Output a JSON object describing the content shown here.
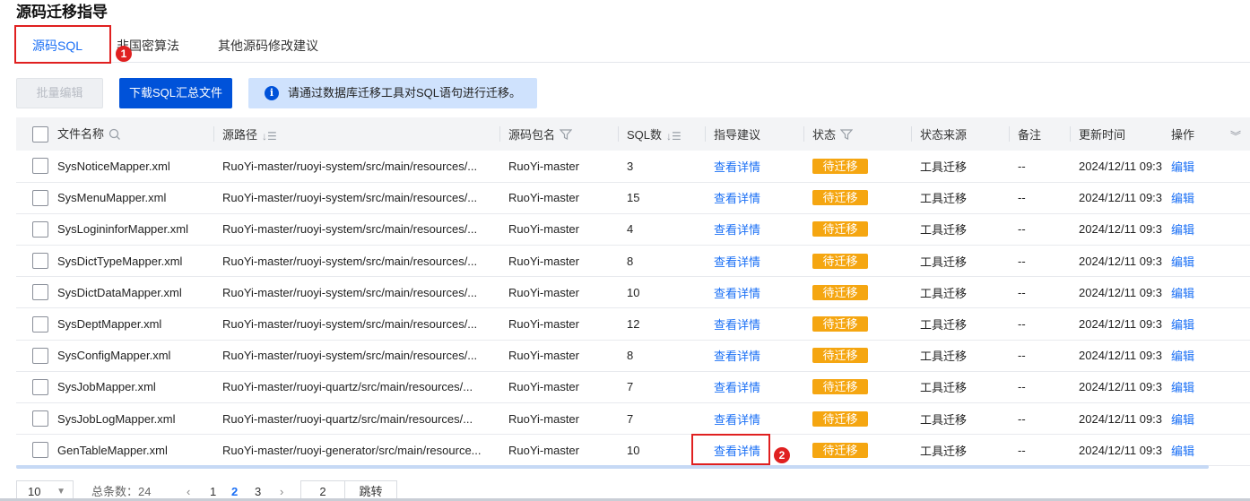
{
  "page": {
    "title": "源码迁移指导"
  },
  "tabs": [
    {
      "label": "源码SQL",
      "active": true
    },
    {
      "label": "非国密算法",
      "active": false
    },
    {
      "label": "其他源码修改建议",
      "active": false
    }
  ],
  "annotations": {
    "badge1": "1",
    "badge2": "2"
  },
  "toolbar": {
    "batch_edit": "批量编辑",
    "download": "下载SQL汇总文件",
    "notice_icon": "i",
    "notice": "请通过数据库迁移工具对SQL语句进行迁移。"
  },
  "table": {
    "headers": {
      "name": "文件名称",
      "path": "源路径",
      "package": "源码包名",
      "sql_count": "SQL数",
      "guide": "指导建议",
      "status": "状态",
      "status_source": "状态来源",
      "note": "备注",
      "update_time": "更新时间",
      "operation": "操作"
    },
    "rows": [
      {
        "name": "SysNoticeMapper.xml",
        "path": "RuoYi-master/ruoyi-system/src/main/resources/...",
        "package": "RuoYi-master",
        "sql_count": "3",
        "guide": "查看详情",
        "status": "待迁移",
        "status_source": "工具迁移",
        "note": "--",
        "update_time": "2024/12/11 09:3",
        "operation": "编辑"
      },
      {
        "name": "SysMenuMapper.xml",
        "path": "RuoYi-master/ruoyi-system/src/main/resources/...",
        "package": "RuoYi-master",
        "sql_count": "15",
        "guide": "查看详情",
        "status": "待迁移",
        "status_source": "工具迁移",
        "note": "--",
        "update_time": "2024/12/11 09:3",
        "operation": "编辑"
      },
      {
        "name": "SysLogininforMapper.xml",
        "path": "RuoYi-master/ruoyi-system/src/main/resources/...",
        "package": "RuoYi-master",
        "sql_count": "4",
        "guide": "查看详情",
        "status": "待迁移",
        "status_source": "工具迁移",
        "note": "--",
        "update_time": "2024/12/11 09:3",
        "operation": "编辑"
      },
      {
        "name": "SysDictTypeMapper.xml",
        "path": "RuoYi-master/ruoyi-system/src/main/resources/...",
        "package": "RuoYi-master",
        "sql_count": "8",
        "guide": "查看详情",
        "status": "待迁移",
        "status_source": "工具迁移",
        "note": "--",
        "update_time": "2024/12/11 09:3",
        "operation": "编辑"
      },
      {
        "name": "SysDictDataMapper.xml",
        "path": "RuoYi-master/ruoyi-system/src/main/resources/...",
        "package": "RuoYi-master",
        "sql_count": "10",
        "guide": "查看详情",
        "status": "待迁移",
        "status_source": "工具迁移",
        "note": "--",
        "update_time": "2024/12/11 09:3",
        "operation": "编辑"
      },
      {
        "name": "SysDeptMapper.xml",
        "path": "RuoYi-master/ruoyi-system/src/main/resources/...",
        "package": "RuoYi-master",
        "sql_count": "12",
        "guide": "查看详情",
        "status": "待迁移",
        "status_source": "工具迁移",
        "note": "--",
        "update_time": "2024/12/11 09:3",
        "operation": "编辑"
      },
      {
        "name": "SysConfigMapper.xml",
        "path": "RuoYi-master/ruoyi-system/src/main/resources/...",
        "package": "RuoYi-master",
        "sql_count": "8",
        "guide": "查看详情",
        "status": "待迁移",
        "status_source": "工具迁移",
        "note": "--",
        "update_time": "2024/12/11 09:3",
        "operation": "编辑"
      },
      {
        "name": "SysJobMapper.xml",
        "path": "RuoYi-master/ruoyi-quartz/src/main/resources/...",
        "package": "RuoYi-master",
        "sql_count": "7",
        "guide": "查看详情",
        "status": "待迁移",
        "status_source": "工具迁移",
        "note": "--",
        "update_time": "2024/12/11 09:3",
        "operation": "编辑"
      },
      {
        "name": "SysJobLogMapper.xml",
        "path": "RuoYi-master/ruoyi-quartz/src/main/resources/...",
        "package": "RuoYi-master",
        "sql_count": "7",
        "guide": "查看详情",
        "status": "待迁移",
        "status_source": "工具迁移",
        "note": "--",
        "update_time": "2024/12/11 09:3",
        "operation": "编辑"
      },
      {
        "name": "GenTableMapper.xml",
        "path": "RuoYi-master/ruoyi-generator/src/main/resource...",
        "package": "RuoYi-master",
        "sql_count": "10",
        "guide": "查看详情",
        "status": "待迁移",
        "status_source": "工具迁移",
        "note": "--",
        "update_time": "2024/12/11 09:3",
        "operation": "编辑"
      }
    ]
  },
  "pagination": {
    "page_size": "10",
    "total_label": "总条数：24",
    "pages": [
      "1",
      "2",
      "3"
    ],
    "current_page": "2",
    "jump_value": "2",
    "jump_label": "跳转"
  },
  "colors": {
    "primary": "#0052d9",
    "link": "#1a6ff5",
    "pending": "#f5a611",
    "annotation": "#e02020",
    "notice_bg": "#cfe2fd"
  }
}
